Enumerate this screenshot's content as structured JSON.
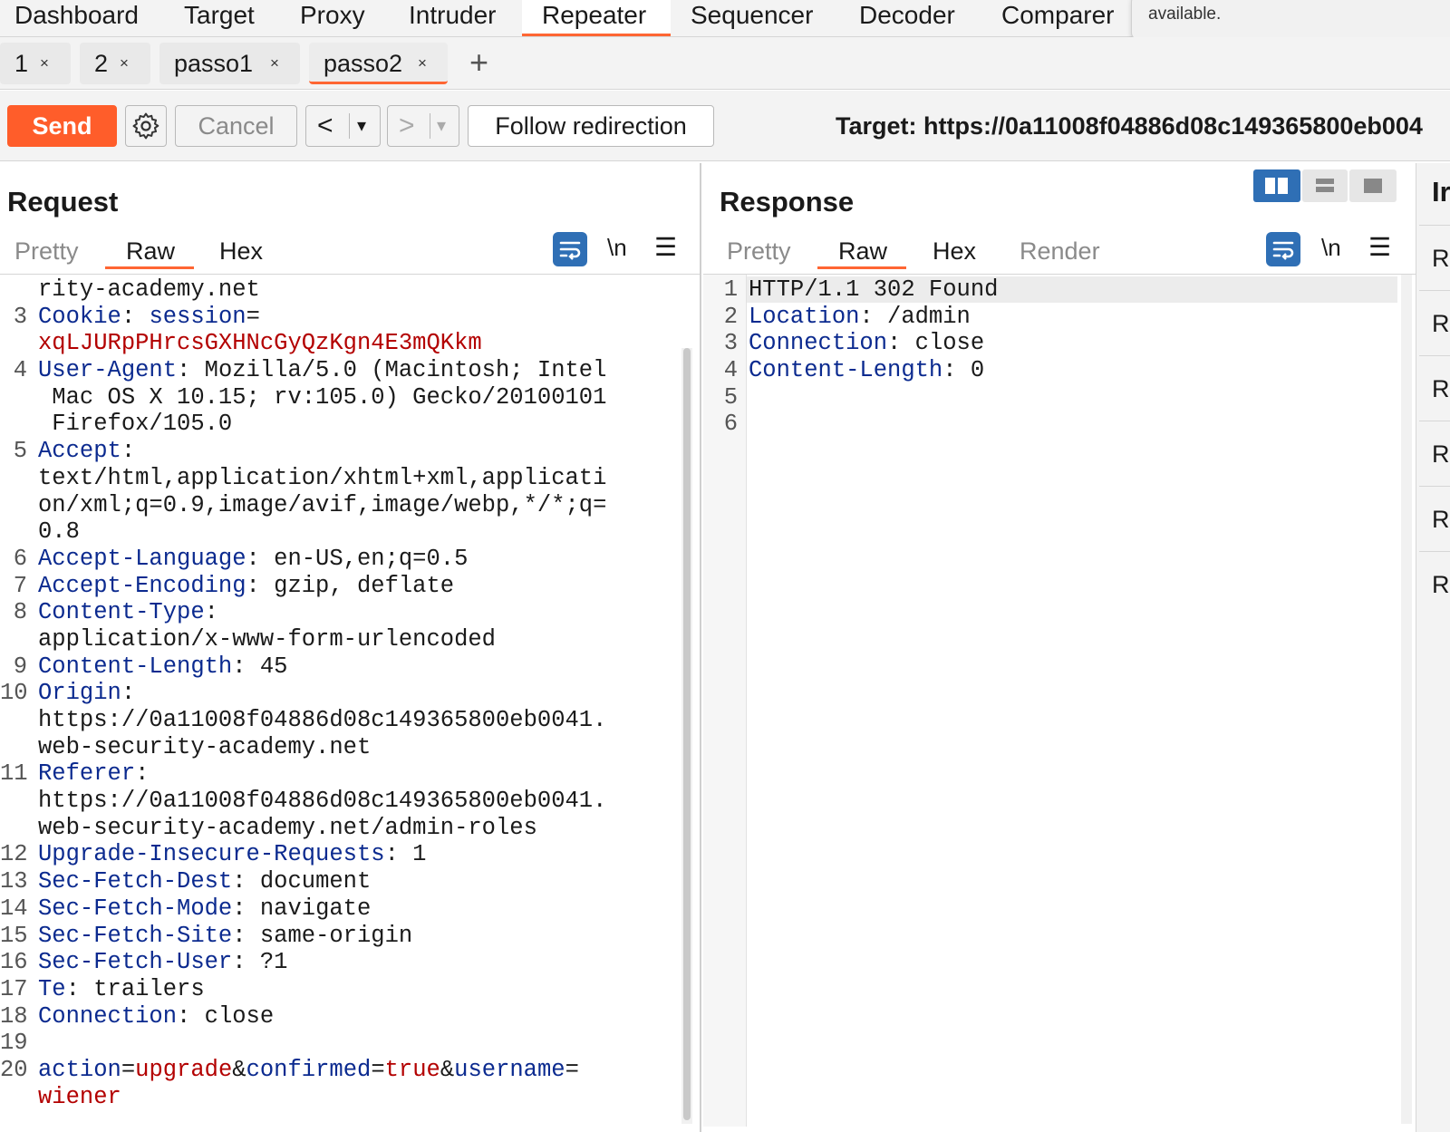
{
  "top_nav": {
    "items": [
      "Dashboard",
      "Target",
      "Proxy",
      "Intruder",
      "Repeater",
      "Sequencer",
      "Decoder",
      "Comparer"
    ],
    "active": "Repeater",
    "toast_text": "available."
  },
  "repeater_tabs": {
    "tabs": [
      {
        "label": "1",
        "close": "×"
      },
      {
        "label": "2",
        "close": "×"
      },
      {
        "label": "passo1",
        "close": "×"
      },
      {
        "label": "passo2",
        "close": "×"
      }
    ],
    "active": "passo2",
    "add_label": "+"
  },
  "toolbar": {
    "send_label": "Send",
    "cancel_label": "Cancel",
    "back_label": "<",
    "forward_label": ">",
    "dropdown_label": "▾",
    "follow_label": "Follow redirection",
    "target_label": "Target: https://0a11008f04886d08c149365800eb004"
  },
  "request": {
    "title": "Request",
    "tabs": [
      "Pretty",
      "Raw",
      "Hex"
    ],
    "active_tab": "Raw",
    "newline_label": "\\n",
    "lines": [
      {
        "n": "",
        "parts": [
          {
            "t": "rity-academy.net",
            "c": "v"
          }
        ]
      },
      {
        "n": "3",
        "parts": [
          {
            "t": "Cookie",
            "c": "k"
          },
          {
            "t": ": ",
            "c": "v"
          },
          {
            "t": "session",
            "c": "k"
          },
          {
            "t": "=",
            "c": "v"
          }
        ]
      },
      {
        "n": "",
        "parts": [
          {
            "t": "xqLJURpPHrcsGXHNcGyQzKgn4E3mQKkm",
            "c": "r"
          }
        ]
      },
      {
        "n": "4",
        "parts": [
          {
            "t": "User-Agent",
            "c": "k"
          },
          {
            "t": ": Mozilla/5.0 (Macintosh; Intel",
            "c": "v"
          }
        ]
      },
      {
        "n": "",
        "parts": [
          {
            "t": " Mac OS X 10.15; rv:105.0) Gecko/20100101",
            "c": "v"
          }
        ]
      },
      {
        "n": "",
        "parts": [
          {
            "t": " Firefox/105.0",
            "c": "v"
          }
        ]
      },
      {
        "n": "5",
        "parts": [
          {
            "t": "Accept",
            "c": "k"
          },
          {
            "t": ":",
            "c": "v"
          }
        ]
      },
      {
        "n": "",
        "parts": [
          {
            "t": "text/html,application/xhtml+xml,applicati",
            "c": "v"
          }
        ]
      },
      {
        "n": "",
        "parts": [
          {
            "t": "on/xml;q=0.9,image/avif,image/webp,*/*;q=",
            "c": "v"
          }
        ]
      },
      {
        "n": "",
        "parts": [
          {
            "t": "0.8",
            "c": "v"
          }
        ]
      },
      {
        "n": "6",
        "parts": [
          {
            "t": "Accept-Language",
            "c": "k"
          },
          {
            "t": ": en-US,en;q=0.5",
            "c": "v"
          }
        ]
      },
      {
        "n": "7",
        "parts": [
          {
            "t": "Accept-Encoding",
            "c": "k"
          },
          {
            "t": ": gzip, deflate",
            "c": "v"
          }
        ]
      },
      {
        "n": "8",
        "parts": [
          {
            "t": "Content-Type",
            "c": "k"
          },
          {
            "t": ":",
            "c": "v"
          }
        ]
      },
      {
        "n": "",
        "parts": [
          {
            "t": "application/x-www-form-urlencoded",
            "c": "v"
          }
        ]
      },
      {
        "n": "9",
        "parts": [
          {
            "t": "Content-Length",
            "c": "k"
          },
          {
            "t": ": 45",
            "c": "v"
          }
        ]
      },
      {
        "n": "10",
        "parts": [
          {
            "t": "Origin",
            "c": "k"
          },
          {
            "t": ":",
            "c": "v"
          }
        ]
      },
      {
        "n": "",
        "parts": [
          {
            "t": "https://0a11008f04886d08c149365800eb0041.",
            "c": "v"
          }
        ]
      },
      {
        "n": "",
        "parts": [
          {
            "t": "web-security-academy.net",
            "c": "v"
          }
        ]
      },
      {
        "n": "11",
        "parts": [
          {
            "t": "Referer",
            "c": "k"
          },
          {
            "t": ":",
            "c": "v"
          }
        ]
      },
      {
        "n": "",
        "parts": [
          {
            "t": "https://0a11008f04886d08c149365800eb0041.",
            "c": "v"
          }
        ]
      },
      {
        "n": "",
        "parts": [
          {
            "t": "web-security-academy.net/admin-roles",
            "c": "v"
          }
        ]
      },
      {
        "n": "12",
        "parts": [
          {
            "t": "Upgrade-Insecure-Requests",
            "c": "k"
          },
          {
            "t": ": 1",
            "c": "v"
          }
        ]
      },
      {
        "n": "13",
        "parts": [
          {
            "t": "Sec-Fetch-Dest",
            "c": "k"
          },
          {
            "t": ": document",
            "c": "v"
          }
        ]
      },
      {
        "n": "14",
        "parts": [
          {
            "t": "Sec-Fetch-Mode",
            "c": "k"
          },
          {
            "t": ": navigate",
            "c": "v"
          }
        ]
      },
      {
        "n": "15",
        "parts": [
          {
            "t": "Sec-Fetch-Site",
            "c": "k"
          },
          {
            "t": ": same-origin",
            "c": "v"
          }
        ]
      },
      {
        "n": "16",
        "parts": [
          {
            "t": "Sec-Fetch-User",
            "c": "k"
          },
          {
            "t": ": ?1",
            "c": "v"
          }
        ]
      },
      {
        "n": "17",
        "parts": [
          {
            "t": "Te",
            "c": "k"
          },
          {
            "t": ": trailers",
            "c": "v"
          }
        ]
      },
      {
        "n": "18",
        "parts": [
          {
            "t": "Connection",
            "c": "k"
          },
          {
            "t": ": close",
            "c": "v"
          }
        ]
      },
      {
        "n": "19",
        "parts": []
      },
      {
        "n": "20",
        "parts": [
          {
            "t": "action",
            "c": "k"
          },
          {
            "t": "=",
            "c": "v"
          },
          {
            "t": "upgrade",
            "c": "r"
          },
          {
            "t": "&",
            "c": "v"
          },
          {
            "t": "confirmed",
            "c": "k"
          },
          {
            "t": "=",
            "c": "v"
          },
          {
            "t": "true",
            "c": "r"
          },
          {
            "t": "&",
            "c": "v"
          },
          {
            "t": "username",
            "c": "k"
          },
          {
            "t": "=",
            "c": "v"
          }
        ]
      },
      {
        "n": "",
        "parts": [
          {
            "t": "wiener",
            "c": "r"
          }
        ]
      }
    ]
  },
  "response": {
    "title": "Response",
    "tabs": [
      "Pretty",
      "Raw",
      "Hex",
      "Render"
    ],
    "active_tab": "Raw",
    "newline_label": "\\n",
    "lines": [
      {
        "n": "1",
        "parts": [
          {
            "t": "HTTP/1.1 302 Found",
            "c": "v"
          }
        ]
      },
      {
        "n": "2",
        "parts": [
          {
            "t": "Location",
            "c": "k"
          },
          {
            "t": ": /admin",
            "c": "v"
          }
        ]
      },
      {
        "n": "3",
        "parts": [
          {
            "t": "Connection",
            "c": "k"
          },
          {
            "t": ": close",
            "c": "v"
          }
        ]
      },
      {
        "n": "4",
        "parts": [
          {
            "t": "Content-Length",
            "c": "k"
          },
          {
            "t": ": 0",
            "c": "v"
          }
        ]
      },
      {
        "n": "5",
        "parts": []
      },
      {
        "n": "6",
        "parts": []
      }
    ]
  },
  "inspector": {
    "title": "Ir",
    "items": [
      "R",
      "R",
      "R",
      "R",
      "R",
      "R"
    ]
  },
  "colors": {
    "accent": "#ff6633",
    "send": "#ff5d2a",
    "header_key": "#0b2a8f",
    "value_red": "#b30000",
    "toggle_blue": "#2f6fb5"
  }
}
